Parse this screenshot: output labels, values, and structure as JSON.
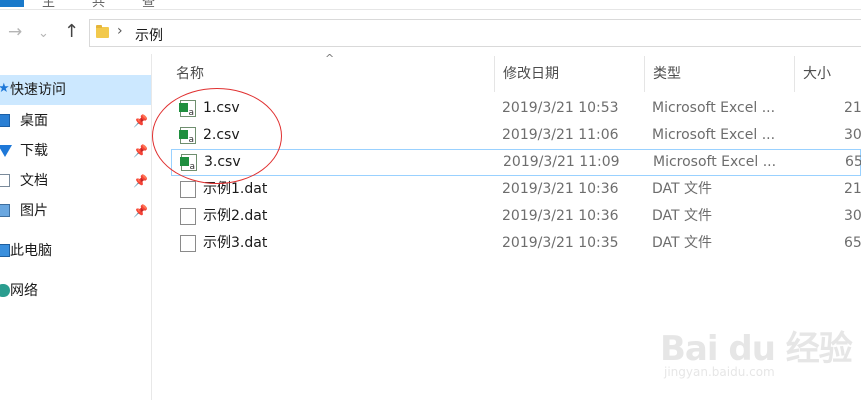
{
  "window": {
    "ribbon_fragments": [
      "主",
      "共",
      "查"
    ]
  },
  "navigation": {
    "back_icon": "arrow-left-icon",
    "forward_icon": "chevron-down-icon",
    "up_icon": "arrow-up-icon",
    "breadcrumb_separator": "›",
    "breadcrumb": [
      "示例"
    ]
  },
  "sidebar": {
    "items": [
      {
        "label": "快速访问",
        "icon": "star-icon",
        "active": true
      },
      {
        "label": "桌面",
        "icon": "desktop-icon",
        "pinned": true
      },
      {
        "label": "下载",
        "icon": "download-icon",
        "pinned": true
      },
      {
        "label": "文档",
        "icon": "documents-icon",
        "pinned": true
      },
      {
        "label": "图片",
        "icon": "pictures-icon",
        "pinned": true
      },
      {
        "label": "此电脑",
        "icon": "computer-icon"
      },
      {
        "label": "网络",
        "icon": "network-icon"
      }
    ],
    "pin_glyph": "📌"
  },
  "file_list": {
    "sort_indicator": "^",
    "columns": [
      "名称",
      "修改日期",
      "类型",
      "大小"
    ],
    "rows": [
      {
        "name": "1.csv",
        "modified": "2019/3/21 10:53",
        "type": "Microsoft Excel ...",
        "size": "21",
        "icon": "excel-csv-icon"
      },
      {
        "name": "2.csv",
        "modified": "2019/3/21 11:06",
        "type": "Microsoft Excel ...",
        "size": "30",
        "icon": "excel-csv-icon"
      },
      {
        "name": "3.csv",
        "modified": "2019/3/21 11:09",
        "type": "Microsoft Excel ...",
        "size": "65",
        "icon": "excel-csv-icon",
        "selected": true
      },
      {
        "name": "示例1.dat",
        "modified": "2019/3/21 10:36",
        "type": "DAT 文件",
        "size": "21",
        "icon": "blank-file-icon"
      },
      {
        "name": "示例2.dat",
        "modified": "2019/3/21 10:36",
        "type": "DAT 文件",
        "size": "30",
        "icon": "blank-file-icon"
      },
      {
        "name": "示例3.dat",
        "modified": "2019/3/21 10:35",
        "type": "DAT 文件",
        "size": "65",
        "icon": "blank-file-icon"
      }
    ]
  },
  "annotation": {
    "color": "#e03030"
  },
  "watermark": {
    "logo": "Bai du 经验",
    "url": "jingyan.baidu.com"
  },
  "colors": {
    "selection_bg": "#cce8ff",
    "selection_border": "#99d1ff",
    "accent": "#1979ca"
  }
}
